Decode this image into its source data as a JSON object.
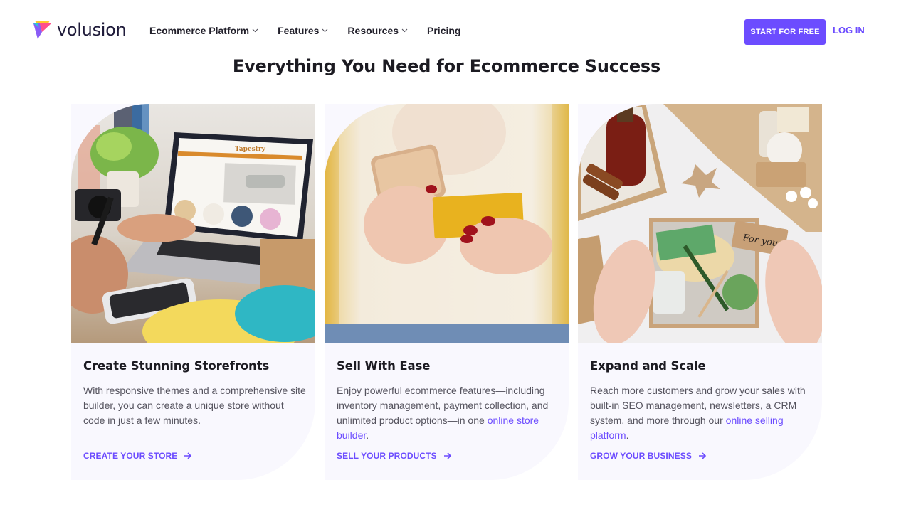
{
  "header": {
    "logo_text": "volusion",
    "nav": [
      {
        "label": "Ecommerce Platform",
        "has_dropdown": true
      },
      {
        "label": "Features",
        "has_dropdown": true
      },
      {
        "label": "Resources",
        "has_dropdown": true
      },
      {
        "label": "Pricing",
        "has_dropdown": false
      }
    ],
    "cta_label": "START FOR FREE",
    "login_label": "LOG IN"
  },
  "section": {
    "title": "Everything You Need for Ecommerce Success"
  },
  "cards": [
    {
      "image_alt": "Person typing on laptop showing an online storefront",
      "title": "Create Stunning Storefronts",
      "description": "With responsive themes and a comprehensive site builder, you can create a unique store without code in just a few minutes.",
      "description_link": "",
      "description_after": "",
      "link_label": "CREATE YOUR STORE"
    },
    {
      "image_alt": "Woman holding a phone and a yellow credit card",
      "title": "Sell With Ease",
      "description": "Enjoy powerful ecommerce features—including inventory management, payment collection, and unlimited product options—in one ",
      "description_link": "online store builder",
      "description_after": ".",
      "link_label": "SELL YOUR PRODUCTS"
    },
    {
      "image_alt": "Hands holding a gift box with a 'For you' tag",
      "title": "Expand and Scale",
      "description": "Reach more customers and grow your sales with built-in SEO management, newsletters, a CRM system, and more through our ",
      "description_link": "online selling platform",
      "description_after": ".",
      "link_label": "GROW YOUR BUSINESS"
    }
  ],
  "colors": {
    "accent": "#6c4cff",
    "card_bg": "#f9f8fe",
    "heading": "#1c1b22",
    "body_text": "#55535e"
  }
}
